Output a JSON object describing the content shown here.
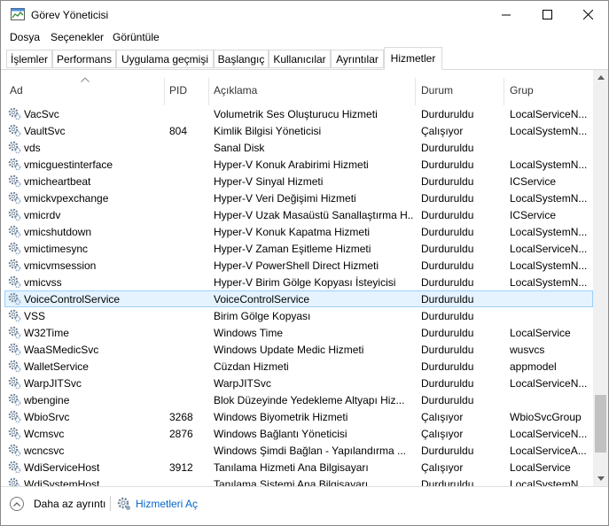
{
  "window": {
    "title": "Görev Yöneticisi"
  },
  "menu": [
    "Dosya",
    "Seçenekler",
    "Görüntüle"
  ],
  "tabs": [
    {
      "label": "İşlemler"
    },
    {
      "label": "Performans"
    },
    {
      "label": "Uygulama geçmişi"
    },
    {
      "label": "Başlangıç"
    },
    {
      "label": "Kullanıcılar"
    },
    {
      "label": "Ayrıntılar"
    },
    {
      "label": "Hizmetler"
    }
  ],
  "active_tab": "Hizmetler",
  "columns": {
    "name": "Ad",
    "pid": "PID",
    "desc": "Açıklama",
    "status": "Durum",
    "group": "Grup"
  },
  "rows": [
    {
      "name": "VacSvc",
      "pid": "",
      "desc": "Volumetrik Ses Oluşturucu Hizmeti",
      "status": "Durduruldu",
      "group": "LocalServiceN..."
    },
    {
      "name": "VaultSvc",
      "pid": "804",
      "desc": "Kimlik Bilgisi Yöneticisi",
      "status": "Çalışıyor",
      "group": "LocalSystemN..."
    },
    {
      "name": "vds",
      "pid": "",
      "desc": "Sanal Disk",
      "status": "Durduruldu",
      "group": ""
    },
    {
      "name": "vmicguestinterface",
      "pid": "",
      "desc": "Hyper-V Konuk Arabirimi Hizmeti",
      "status": "Durduruldu",
      "group": "LocalSystemN..."
    },
    {
      "name": "vmicheartbeat",
      "pid": "",
      "desc": "Hyper-V Sinyal Hizmeti",
      "status": "Durduruldu",
      "group": "ICService"
    },
    {
      "name": "vmickvpexchange",
      "pid": "",
      "desc": "Hyper-V Veri Değişimi Hizmeti",
      "status": "Durduruldu",
      "group": "LocalSystemN..."
    },
    {
      "name": "vmicrdv",
      "pid": "",
      "desc": "Hyper-V Uzak Masaüstü Sanallaştırma H...",
      "status": "Durduruldu",
      "group": "ICService"
    },
    {
      "name": "vmicshutdown",
      "pid": "",
      "desc": "Hyper-V Konuk Kapatma Hizmeti",
      "status": "Durduruldu",
      "group": "LocalSystemN..."
    },
    {
      "name": "vmictimesync",
      "pid": "",
      "desc": "Hyper-V Zaman Eşitleme Hizmeti",
      "status": "Durduruldu",
      "group": "LocalServiceN..."
    },
    {
      "name": "vmicvmsession",
      "pid": "",
      "desc": "Hyper-V PowerShell Direct Hizmeti",
      "status": "Durduruldu",
      "group": "LocalSystemN..."
    },
    {
      "name": "vmicvss",
      "pid": "",
      "desc": "Hyper-V Birim Gölge Kopyası İsteyicisi",
      "status": "Durduruldu",
      "group": "LocalSystemN..."
    },
    {
      "name": "VoiceControlService",
      "pid": "",
      "desc": "VoiceControlService",
      "status": "Durduruldu",
      "group": "",
      "selected": true
    },
    {
      "name": "VSS",
      "pid": "",
      "desc": "Birim Gölge Kopyası",
      "status": "Durduruldu",
      "group": ""
    },
    {
      "name": "W32Time",
      "pid": "",
      "desc": "Windows Time",
      "status": "Durduruldu",
      "group": "LocalService"
    },
    {
      "name": "WaaSMedicSvc",
      "pid": "",
      "desc": "Windows Update Medic Hizmeti",
      "status": "Durduruldu",
      "group": "wusvcs"
    },
    {
      "name": "WalletService",
      "pid": "",
      "desc": "Cüzdan Hizmeti",
      "status": "Durduruldu",
      "group": "appmodel"
    },
    {
      "name": "WarpJITSvc",
      "pid": "",
      "desc": "WarpJITSvc",
      "status": "Durduruldu",
      "group": "LocalServiceN..."
    },
    {
      "name": "wbengine",
      "pid": "",
      "desc": "Blok Düzeyinde Yedekleme Altyapı Hiz...",
      "status": "Durduruldu",
      "group": ""
    },
    {
      "name": "WbioSrvc",
      "pid": "3268",
      "desc": "Windows Biyometrik Hizmeti",
      "status": "Çalışıyor",
      "group": "WbioSvcGroup"
    },
    {
      "name": "Wcmsvc",
      "pid": "2876",
      "desc": "Windows Bağlantı Yöneticisi",
      "status": "Çalışıyor",
      "group": "LocalServiceN..."
    },
    {
      "name": "wcncsvc",
      "pid": "",
      "desc": "Windows Şimdi Bağlan - Yapılandırma ...",
      "status": "Durduruldu",
      "group": "LocalServiceA..."
    },
    {
      "name": "WdiServiceHost",
      "pid": "3912",
      "desc": "Tanılama Hizmeti Ana Bilgisayarı",
      "status": "Çalışıyor",
      "group": "LocalService"
    },
    {
      "name": "WdiSystemHost",
      "pid": "",
      "desc": "Tanılama Sistemi Ana Bilgisayarı",
      "status": "Durduruldu",
      "group": "LocalSystemN..."
    }
  ],
  "footer": {
    "fewer_details": "Daha az ayrıntı",
    "open_services": "Hizmetleri Aç"
  },
  "colors": {
    "selection_bg": "#e5f3ff",
    "selection_border": "#99d1ff",
    "link": "#0066cc",
    "scroll_thumb": "#c1c1c1"
  },
  "icons": {
    "app": "task-manager-icon",
    "service": "gear-icon",
    "fewer": "chevron-up-icon",
    "open_services": "services-gear-icon"
  }
}
